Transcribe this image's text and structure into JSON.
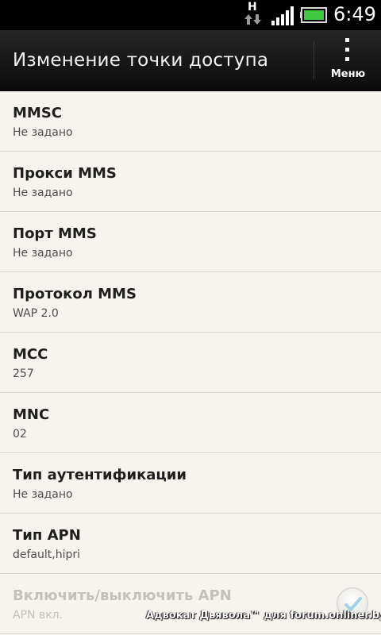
{
  "status_bar": {
    "network_type": "H",
    "time": "6:49",
    "icons": [
      "data-arrows-icon",
      "signal-icon",
      "battery-icon"
    ],
    "battery_color": "#3ec93e"
  },
  "action_bar": {
    "title": "Изменение точки доступа",
    "menu_label": "Меню",
    "menu_icon": "overflow-menu-icon"
  },
  "settings": [
    {
      "title": "MMSC",
      "value": "Не задано"
    },
    {
      "title": "Прокси MMS",
      "value": "Не задано"
    },
    {
      "title": "Порт MMS",
      "value": "Не задано"
    },
    {
      "title": "Протокол MMS",
      "value": "WAP 2.0"
    },
    {
      "title": "MCC",
      "value": "257"
    },
    {
      "title": "MNC",
      "value": "02"
    },
    {
      "title": "Тип аутентификации",
      "value": "Не задано"
    },
    {
      "title": "Тип APN",
      "value": "default,hipri"
    },
    {
      "title": "Включить/выключить APN",
      "value": "APN вкл.",
      "checked": true,
      "enabled": false
    }
  ],
  "watermark": "Адвокат Дьявола™ для forum.onliner.by"
}
